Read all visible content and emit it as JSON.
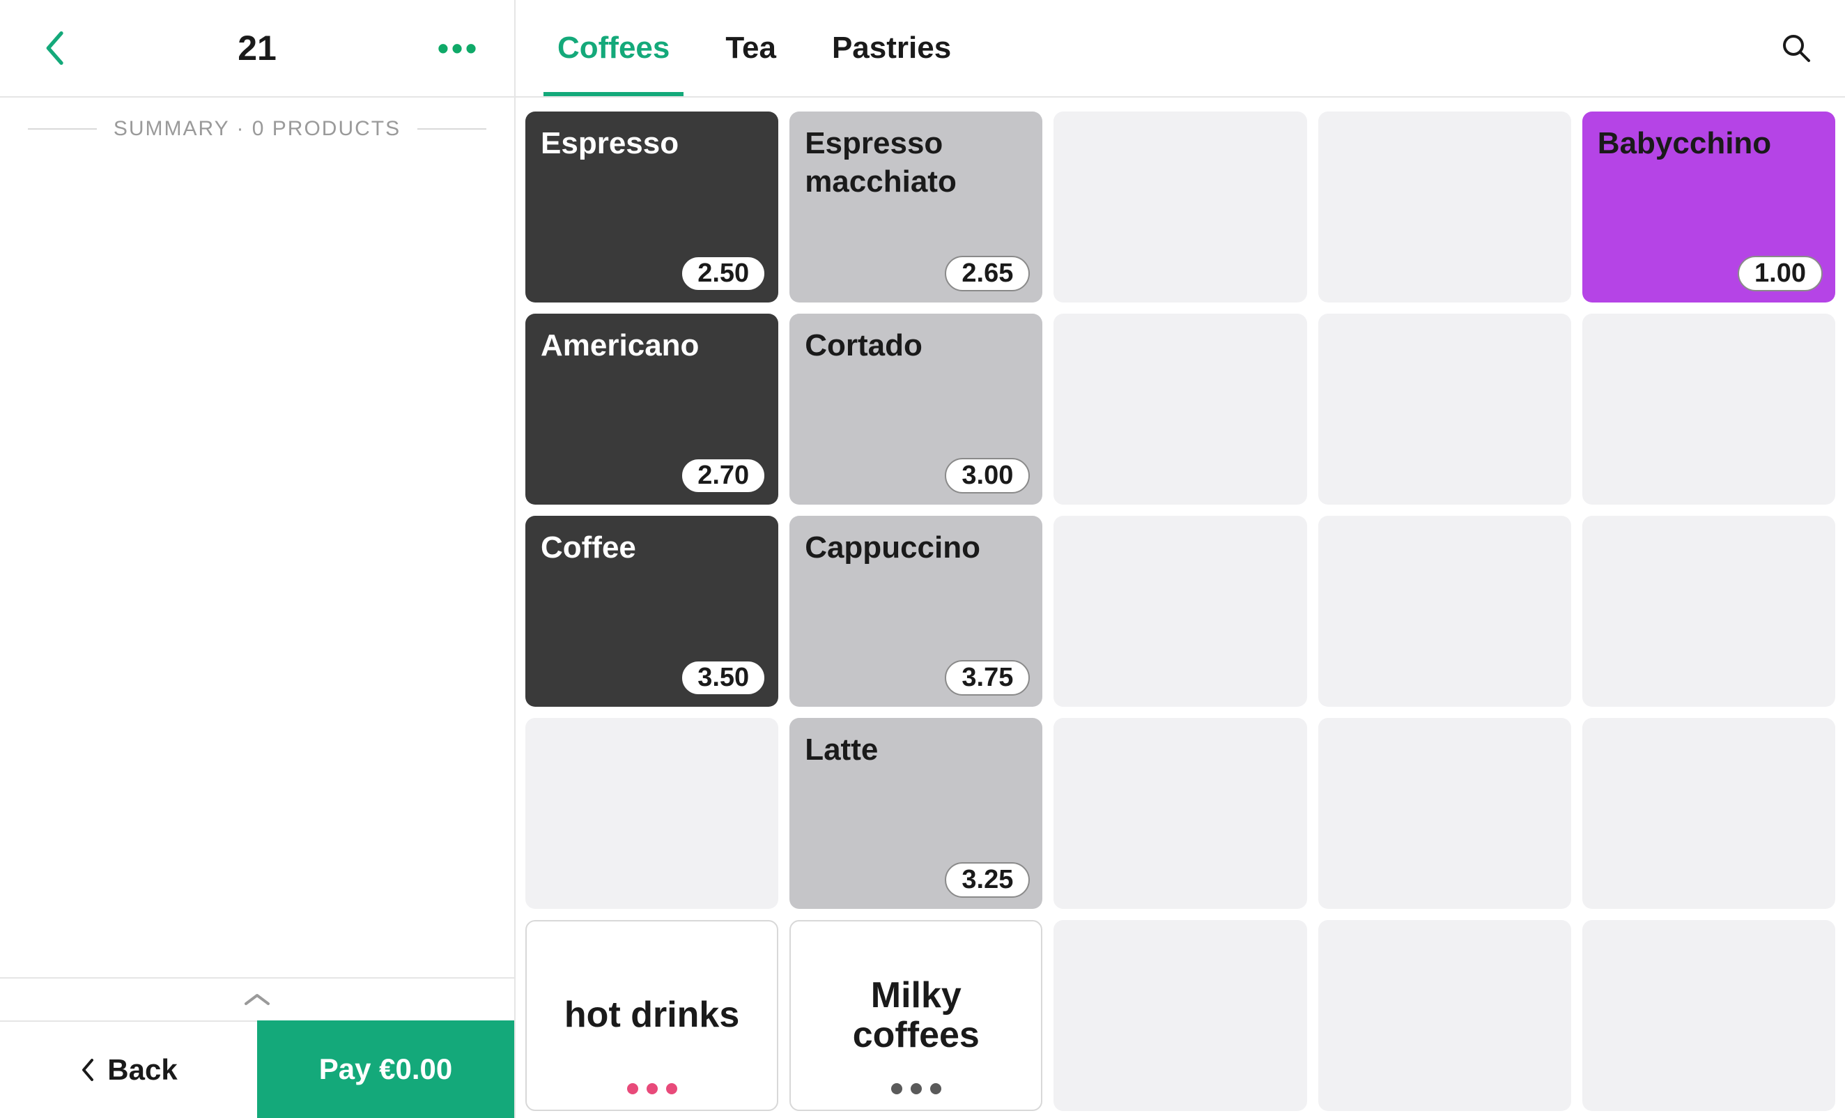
{
  "left": {
    "order_number": "21",
    "summary_label": "SUMMARY · 0 PRODUCTS",
    "back_label": "Back",
    "pay_label": "Pay €0.00"
  },
  "tabs": [
    {
      "label": "Coffees",
      "active": true
    },
    {
      "label": "Tea",
      "active": false
    },
    {
      "label": "Pastries",
      "active": false
    }
  ],
  "grid": [
    {
      "type": "product",
      "style": "dark",
      "name": "Espresso",
      "price": "2.50"
    },
    {
      "type": "product",
      "style": "grey",
      "name": "Espresso macchiato",
      "price": "2.65"
    },
    {
      "type": "empty"
    },
    {
      "type": "empty"
    },
    {
      "type": "product",
      "style": "purple",
      "name": "Babycchino",
      "price": "1.00"
    },
    {
      "type": "product",
      "style": "dark",
      "name": "Americano",
      "price": "2.70"
    },
    {
      "type": "product",
      "style": "grey",
      "name": "Cortado",
      "price": "3.00"
    },
    {
      "type": "empty"
    },
    {
      "type": "empty"
    },
    {
      "type": "empty"
    },
    {
      "type": "product",
      "style": "dark",
      "name": "Coffee",
      "price": "3.50"
    },
    {
      "type": "product",
      "style": "grey",
      "name": "Cappuccino",
      "price": "3.75"
    },
    {
      "type": "empty"
    },
    {
      "type": "empty"
    },
    {
      "type": "empty"
    },
    {
      "type": "empty"
    },
    {
      "type": "product",
      "style": "grey",
      "name": "Latte",
      "price": "3.25"
    },
    {
      "type": "empty"
    },
    {
      "type": "empty"
    },
    {
      "type": "empty"
    },
    {
      "type": "sub",
      "name": "hot drinks",
      "dots": "pink"
    },
    {
      "type": "sub",
      "name": "Milky coffees",
      "dots": "greyD"
    },
    {
      "type": "empty"
    },
    {
      "type": "empty"
    },
    {
      "type": "empty"
    }
  ]
}
